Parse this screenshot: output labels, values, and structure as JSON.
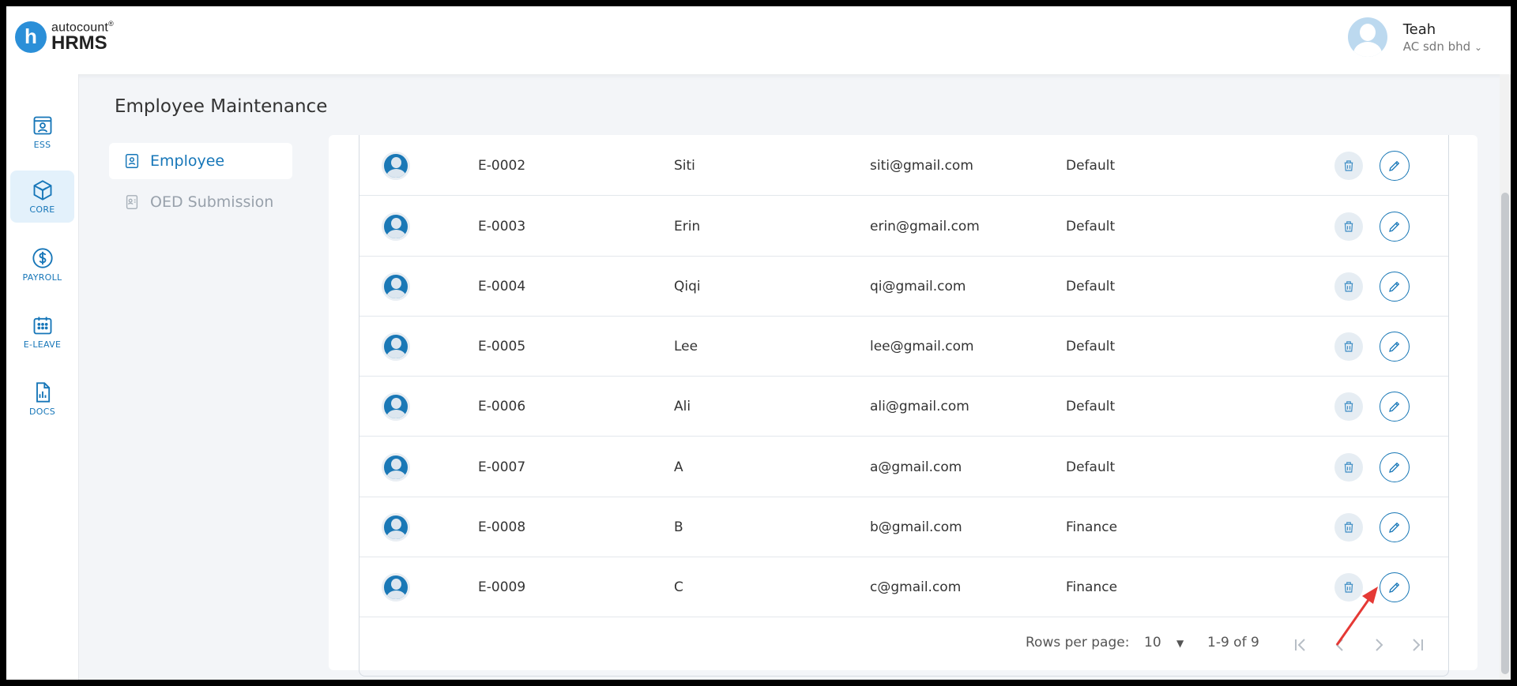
{
  "header": {
    "logo_letter": "h",
    "logo_top": "autocount",
    "logo_bottom": "HRMS",
    "user_name": "Teah",
    "company": "AC sdn bhd"
  },
  "rail": {
    "items": [
      {
        "label": "ESS",
        "icon": "ess-icon"
      },
      {
        "label": "CORE",
        "icon": "cube-icon"
      },
      {
        "label": "PAYROLL",
        "icon": "dollar-icon"
      },
      {
        "label": "E-LEAVE",
        "icon": "calendar-icon"
      },
      {
        "label": "DOCS",
        "icon": "document-chart-icon"
      }
    ],
    "active": "CORE"
  },
  "page": {
    "title": "Employee Maintenance"
  },
  "subnav": {
    "items": [
      {
        "label": "Employee",
        "icon": "id-badge-icon",
        "active": true
      },
      {
        "label": "OED Submission",
        "icon": "submission-icon",
        "active": false
      }
    ]
  },
  "table": {
    "rows": [
      {
        "code": "E-0002",
        "name": "Siti",
        "email": "siti@gmail.com",
        "dept": "Default"
      },
      {
        "code": "E-0003",
        "name": "Erin",
        "email": "erin@gmail.com",
        "dept": "Default"
      },
      {
        "code": "E-0004",
        "name": "Qiqi",
        "email": "qi@gmail.com",
        "dept": "Default"
      },
      {
        "code": "E-0005",
        "name": "Lee",
        "email": "lee@gmail.com",
        "dept": "Default"
      },
      {
        "code": "E-0006",
        "name": "Ali",
        "email": "ali@gmail.com",
        "dept": "Default"
      },
      {
        "code": "E-0007",
        "name": "A",
        "email": "a@gmail.com",
        "dept": "Default"
      },
      {
        "code": "E-0008",
        "name": "B",
        "email": "b@gmail.com",
        "dept": "Finance"
      },
      {
        "code": "E-0009",
        "name": "C",
        "email": "c@gmail.com",
        "dept": "Finance"
      }
    ]
  },
  "pagination": {
    "rows_per_page_label": "Rows per page:",
    "rows_per_page_value": "10",
    "range": "1-9 of 9"
  },
  "colors": {
    "accent": "#1676b8",
    "active_bg": "#e3f1fb",
    "annotation": "#e53935"
  }
}
